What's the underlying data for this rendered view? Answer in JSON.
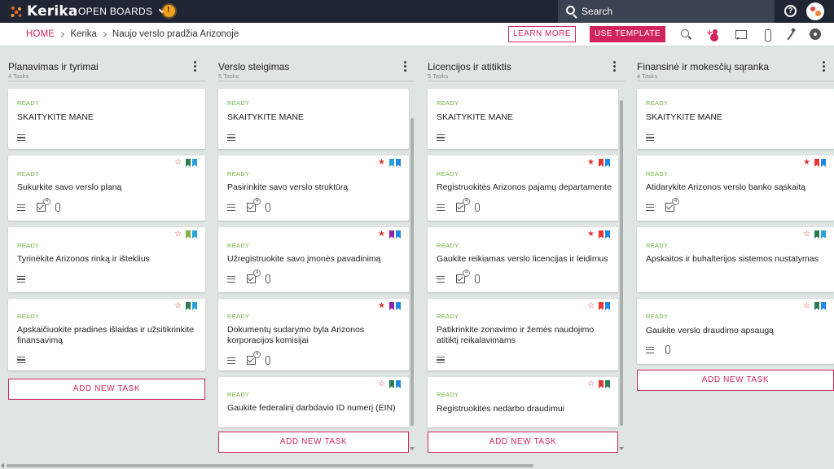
{
  "topbar": {
    "app_name": "Kerika",
    "open_boards_label": "OPEN BOARDS",
    "search_label": "Search",
    "help_label": "?"
  },
  "subbar": {
    "breadcrumb": [
      "HOME",
      "Kerika",
      "Naujo verslo pradžia Arizonoje"
    ],
    "learn_more_label": "LEARN MORE",
    "use_template_label": "USE TEMPLATE"
  },
  "colors": {
    "accent": "#d1245e",
    "ready": "#6fb33f",
    "topbar": "#1f2533",
    "star": "#d93636",
    "tag_green": "#2e7d4f",
    "tag_blue": "#1e88e5",
    "tag_lightblue": "#29a3e0",
    "tag_red": "#e53935",
    "tag_purple": "#8e24aa",
    "tag_lime": "#7cb342"
  },
  "add_task_label": "ADD NEW TASK",
  "columns": [
    {
      "title": "Planavimas ir tyrimai",
      "count": "4 Tasks",
      "cards": [
        {
          "status": "READY",
          "title": "SKAITYKITE MANE"
        },
        {
          "status": "READY",
          "title": "Sukurkite savo verslo planą",
          "checklist": "4"
        },
        {
          "status": "READY",
          "title": "Tyrinėkite Arizonos rinką ir išteklius"
        },
        {
          "status": "READY",
          "title": "Apskaičiuokite pradines išlaidas ir užsitikrinkite finansavimą"
        }
      ]
    },
    {
      "title": "Verslo steigimas",
      "count": "5 Tasks",
      "cards": [
        {
          "status": "READY",
          "title": "SKAITYKITE MANE"
        },
        {
          "status": "READY",
          "title": "Pasirinkite savo verslo struktūrą",
          "checklist": "4"
        },
        {
          "status": "READY",
          "title": "Užregistruokite savo įmonės pavadinimą",
          "checklist": "4"
        },
        {
          "status": "READY",
          "title": "Dokumentų sudarymo byla Arizonos korporacijos komisijai",
          "checklist": "4"
        },
        {
          "status": "READY",
          "title": "Gaukite federalinį darbdavio ID numerį (EIN)"
        }
      ]
    },
    {
      "title": "Licencijos ir atitiktis",
      "count": "5 Tasks",
      "cards": [
        {
          "status": "READY",
          "title": "SKAITYKITE MANE"
        },
        {
          "status": "READY",
          "title": "Registruokitės Arizonos pajamų departamente",
          "checklist": "4"
        },
        {
          "status": "READY",
          "title": "Gaukite reikiamas verslo licencijas ir leidimus",
          "checklist": "4"
        },
        {
          "status": "READY",
          "title": "Patikrinkite zonavimo ir žemės naudojimo atitiktį reikalavimams"
        },
        {
          "status": "READY",
          "title": "Registruokitės nedarbo draudimui"
        }
      ]
    },
    {
      "title": "Finansinė ir mokesčių sąranka",
      "count": "4 Tasks",
      "cards": [
        {
          "status": "READY",
          "title": "SKAITYKITE MANE"
        },
        {
          "status": "READY",
          "title": "Atidarykite Arizonos verslo banko sąskaitą",
          "checklist": "4"
        },
        {
          "status": "READY",
          "title": "Apskaitos ir buhalterijos sistemos nustatymas"
        },
        {
          "status": "READY",
          "title": "Gaukite verslo draudimo apsaugą"
        }
      ]
    }
  ]
}
